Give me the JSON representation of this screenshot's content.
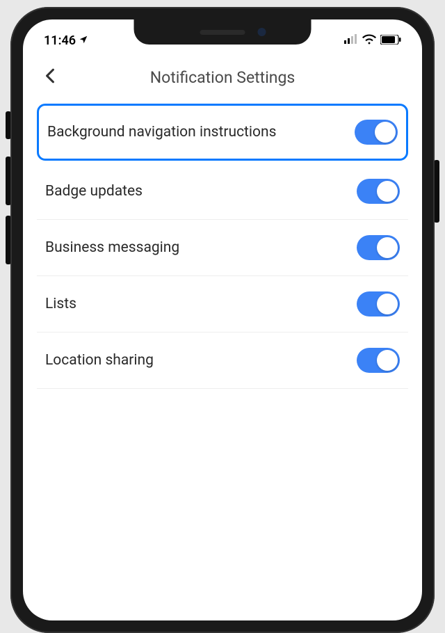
{
  "statusBar": {
    "time": "11:46"
  },
  "header": {
    "title": "Notification Settings"
  },
  "settings": [
    {
      "label": "Background navigation instructions",
      "on": true,
      "highlighted": true
    },
    {
      "label": "Badge updates",
      "on": true,
      "highlighted": false
    },
    {
      "label": "Business messaging",
      "on": true,
      "highlighted": false
    },
    {
      "label": "Lists",
      "on": true,
      "highlighted": false
    },
    {
      "label": "Location sharing",
      "on": true,
      "highlighted": false
    }
  ]
}
